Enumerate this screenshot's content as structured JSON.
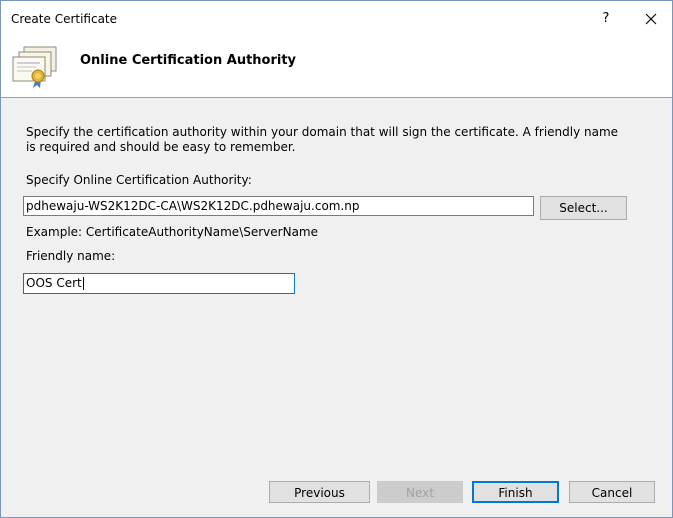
{
  "window": {
    "title": "Create Certificate",
    "help_label": "?"
  },
  "header": {
    "title": "Online Certification Authority",
    "icon": "certificate-icon"
  },
  "content": {
    "description": "Specify the certification authority within your domain that will sign the certificate. A friendly name is required and should be easy to remember.",
    "ca_label": "Specify Online Certification Authority:",
    "ca_value": "pdhewaju-WS2K12DC-CA\\WS2K12DC.pdhewaju.com.np",
    "select_label": "Select...",
    "example": "Example: CertificateAuthorityName\\ServerName",
    "friendly_label": "Friendly name:",
    "friendly_value": "OOS Cert"
  },
  "footer": {
    "previous_label": "Previous",
    "next_label": "Next",
    "finish_label": "Finish",
    "cancel_label": "Cancel"
  },
  "colors": {
    "accent": "#0078d7",
    "background": "#f0f0f0"
  }
}
